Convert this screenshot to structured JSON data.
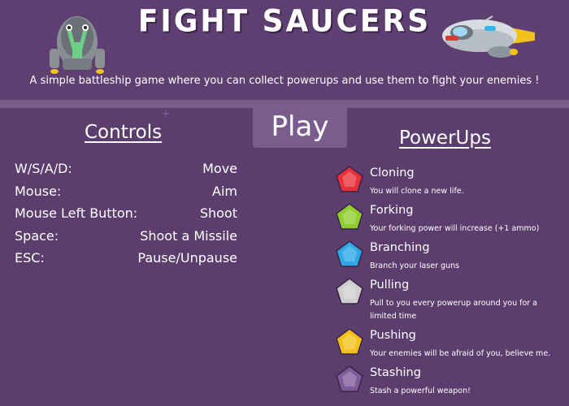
{
  "header": {
    "title": "FIGHT SAUCERS",
    "subtitle": "A simple battleship game where you can collect powerups and use them to fight your enemies !"
  },
  "play_label": "Play",
  "controls": {
    "title": "Controls",
    "rows": [
      {
        "key": "W/S/A/D:",
        "action": "Move"
      },
      {
        "key": "Mouse:",
        "action": "Aim"
      },
      {
        "key": "Mouse Left Button:",
        "action": "Shoot"
      },
      {
        "key": "Space:",
        "action": "Shoot a Missile"
      },
      {
        "key": "ESC:",
        "action": "Pause/Unpause"
      }
    ]
  },
  "powerups": {
    "title": "PowerUps",
    "items": [
      {
        "name": "Cloning",
        "desc": "You will clone a new life.",
        "color": "#e8303a",
        "icon": "red-gem-icon"
      },
      {
        "name": "Forking",
        "desc": "Your forking power will increase (+1 ammo)",
        "color": "#8fcc2e",
        "icon": "green-gem-icon"
      },
      {
        "name": "Branching",
        "desc": "Branch your laser guns",
        "color": "#2fa8e8",
        "icon": "blue-gem-icon"
      },
      {
        "name": "Pulling",
        "desc": "Pull to you every powerup around you for a limited time",
        "color": "#cfcfcf",
        "icon": "white-gem-icon"
      },
      {
        "name": "Pushing",
        "desc": "Your enemies will be afraid of you, believe me.",
        "color": "#f2c21a",
        "icon": "yellow-gem-icon"
      },
      {
        "name": "Stashing",
        "desc": "Stash a powerful weapon!",
        "color": "#7f5a9a",
        "icon": "purple-gem-icon"
      }
    ]
  }
}
